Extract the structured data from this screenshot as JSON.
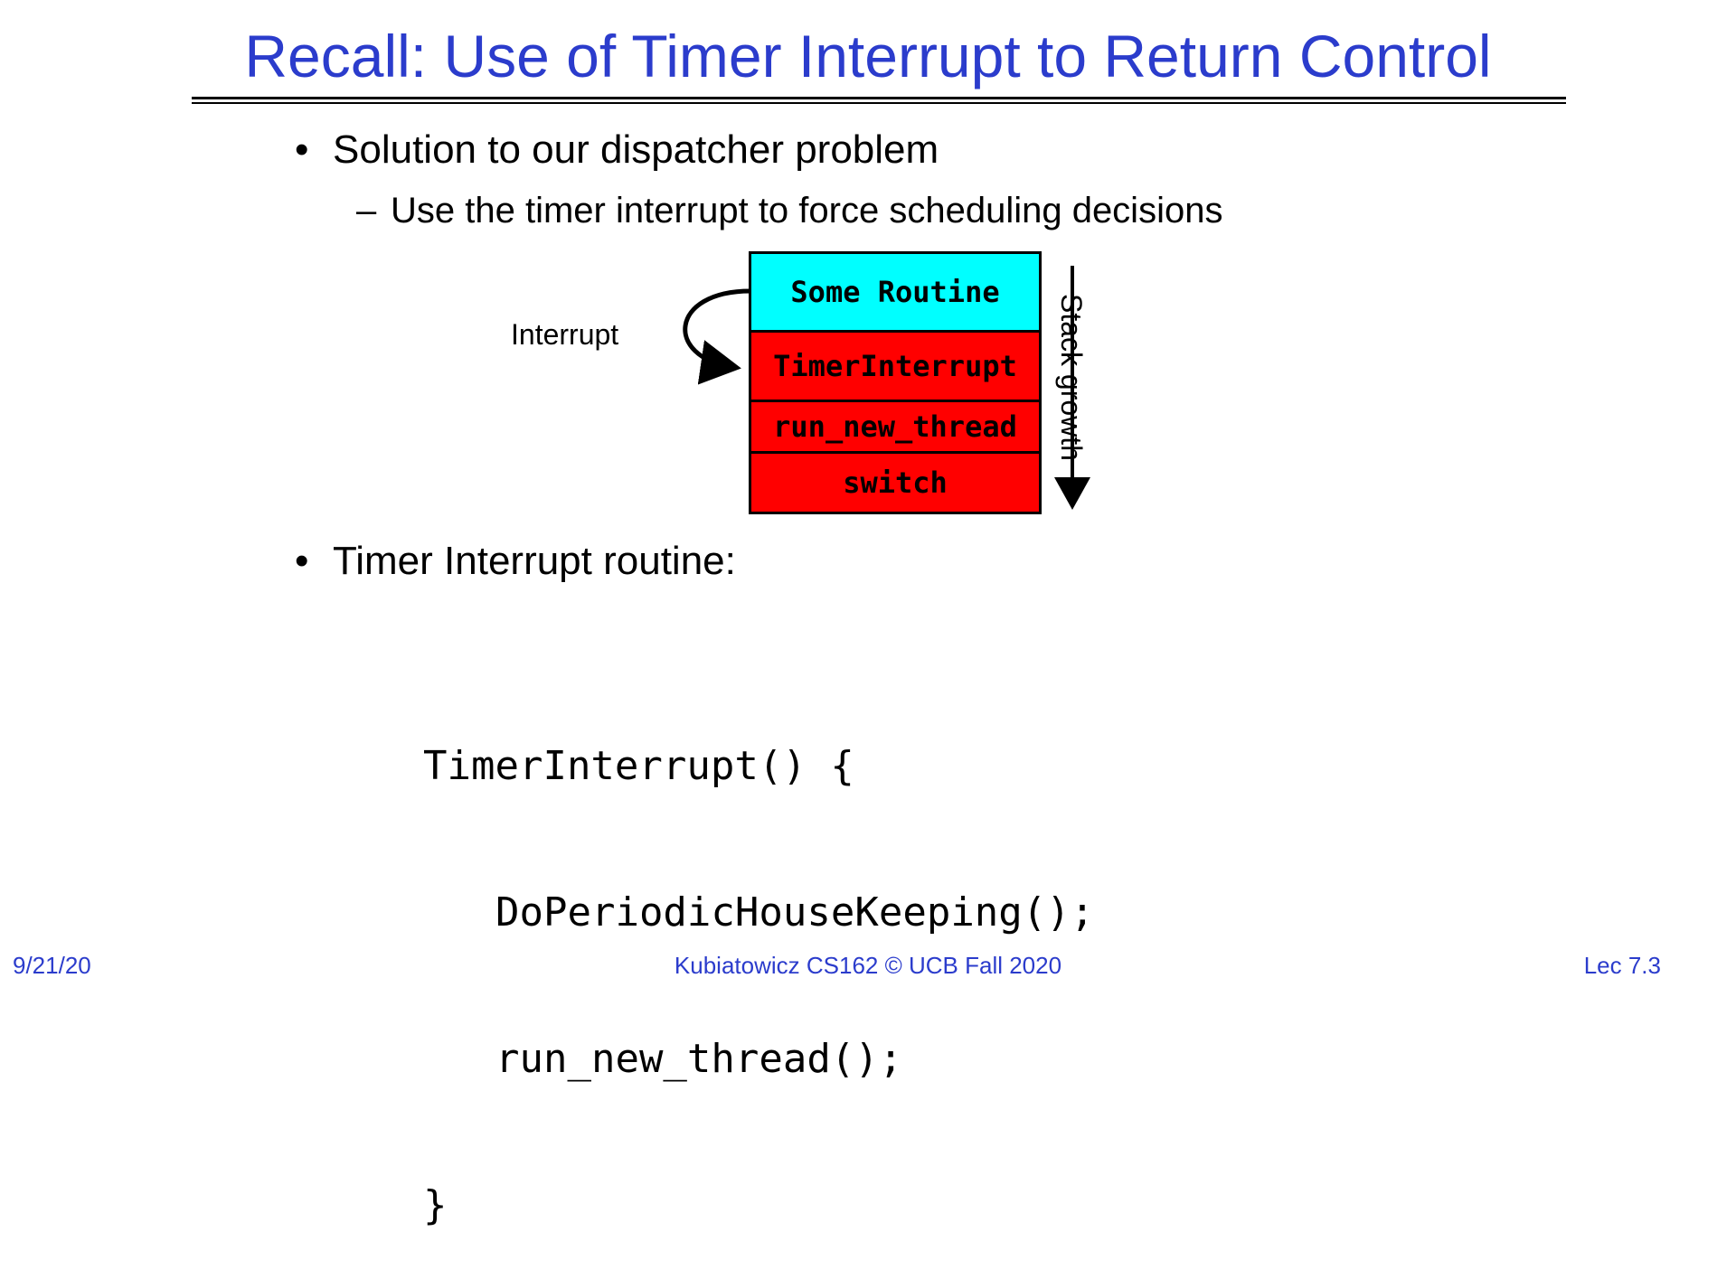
{
  "slide": {
    "title": "Recall: Use of Timer Interrupt to Return Control",
    "bullet1": "Solution to our dispatcher problem",
    "sub1": "Use the timer interrupt to force scheduling decisions",
    "bullet2": "Timer Interrupt routine:",
    "bullet_marker": "•",
    "sub_marker": "–"
  },
  "diagram": {
    "interrupt_label": "Interrupt",
    "stack_growth_label": "Stack growth",
    "frames": [
      "Some Routine",
      "TimerInterrupt",
      "run_new_thread",
      "switch"
    ],
    "colors": {
      "top_frame": "#00ffff",
      "lower_frames": "#ff0000"
    }
  },
  "code": {
    "lines": [
      "TimerInterrupt() {",
      "DoPeriodicHouseKeeping();",
      "run_new_thread();",
      "}"
    ]
  },
  "footer": {
    "date": "9/21/20",
    "course": "Kubiatowicz CS162 © UCB Fall 2020",
    "lecture": "Lec 7.3"
  }
}
